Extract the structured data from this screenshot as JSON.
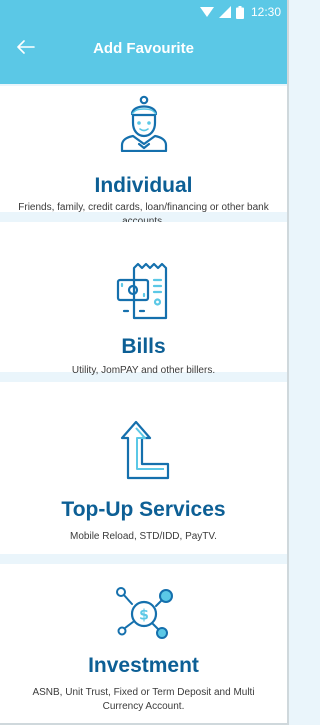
{
  "status_bar": {
    "time": "12:30",
    "icons": [
      "wifi-icon",
      "signal-icon",
      "battery-icon"
    ]
  },
  "header": {
    "title": "Add Favourite",
    "back_icon": "arrow-left-icon"
  },
  "colors": {
    "appbar": "#5bc8e6",
    "heading": "#0d5f95",
    "icon_stroke": "#1570ad",
    "icon_accent": "#5bc8e6"
  },
  "options": [
    {
      "icon": "person-icon",
      "title": "Individual",
      "description": "Friends, family, credit cards, loan/financing or other bank accounts."
    },
    {
      "icon": "bill-icon",
      "title": "Bills",
      "description": "Utility, JomPAY and other billers."
    },
    {
      "icon": "arrow-up-icon",
      "title": "Top-Up Services",
      "description": "Mobile Reload, STD/IDD, PayTV."
    },
    {
      "icon": "investment-icon",
      "title": "Investment",
      "description": "ASNB, Unit Trust, Fixed or Term Deposit and Multi Currency Account."
    }
  ]
}
